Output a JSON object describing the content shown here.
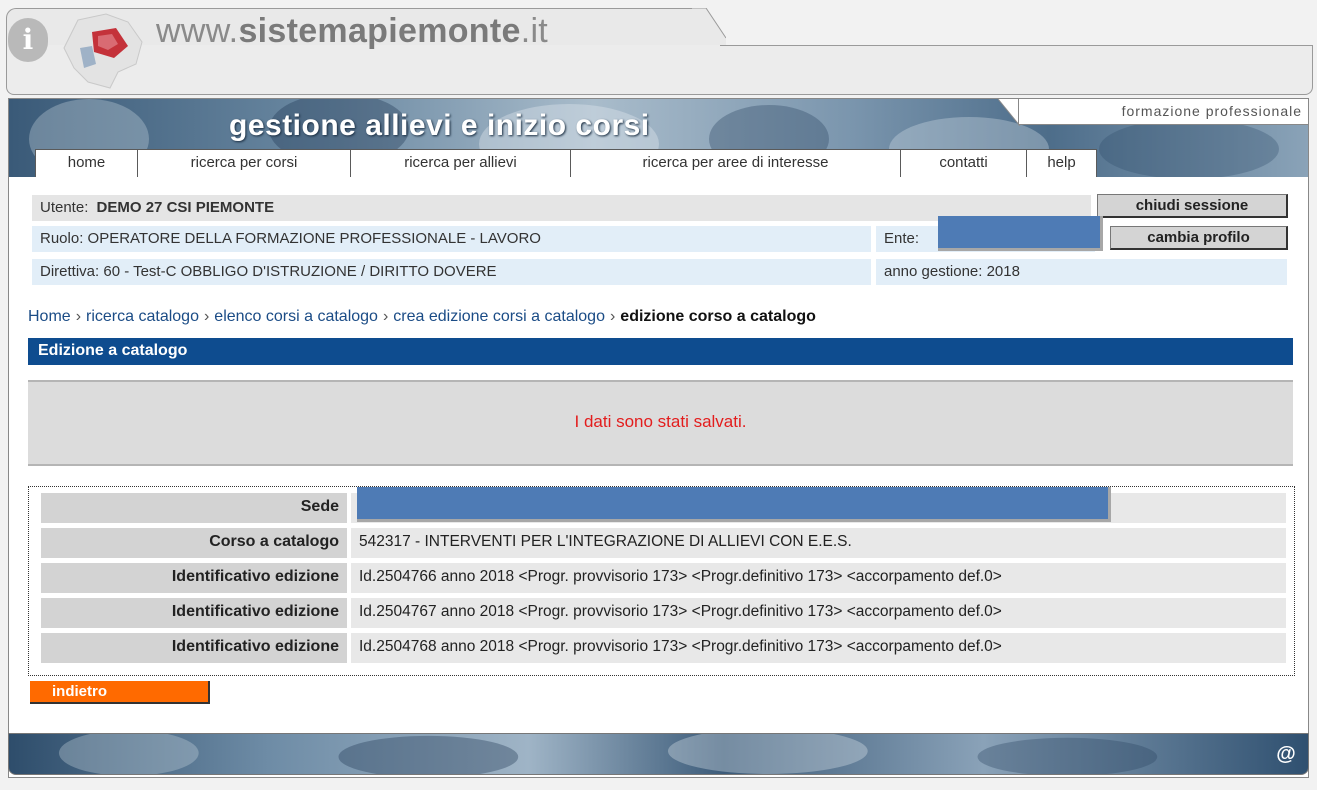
{
  "site": {
    "title_prefix": "www.",
    "title_brand": "sistemapiemonte",
    "title_suffix": ".it",
    "info_icon": "info-icon",
    "logo": "piemonte-region-logo"
  },
  "app": {
    "title": "gestione allievi e inizio corsi",
    "section_label": "formazione professionale"
  },
  "nav": {
    "items": [
      {
        "label": "home"
      },
      {
        "label": "ricerca per corsi"
      },
      {
        "label": "ricerca per allievi"
      },
      {
        "label": "ricerca per aree di interesse"
      },
      {
        "label": "contatti"
      },
      {
        "label": "help"
      }
    ]
  },
  "user": {
    "utente_label": "Utente:",
    "utente_value": "DEMO 27 CSI PIEMONTE",
    "ruolo": "Ruolo: OPERATORE DELLA FORMAZIONE PROFESSIONALE - LAVORO",
    "direttiva": "Direttiva: 60 - Test-C OBBLIGO D'ISTRUZIONE / DIRITTO DOVERE",
    "ente_label": "Ente:",
    "anno": "anno gestione: 2018",
    "chiudi_label": "chiudi sessione",
    "cambia_label": "cambia profilo"
  },
  "breadcrumb": {
    "items": [
      "Home",
      "ricerca catalogo",
      "elenco corsi a catalogo",
      "crea edizione corsi a catalogo"
    ],
    "current": "edizione corso a catalogo",
    "separator": "›"
  },
  "section": {
    "title": "Edizione a catalogo"
  },
  "message": {
    "text": "I dati sono stati salvati."
  },
  "details": {
    "rows": [
      {
        "label": "Sede",
        "value": ""
      },
      {
        "label": "Corso a catalogo",
        "value": "542317 - INTERVENTI PER L'INTEGRAZIONE DI ALLIEVI CON E.E.S."
      },
      {
        "label": "Identificativo edizione",
        "value": "Id.2504766 anno 2018 <Progr. provvisorio 173> <Progr.definitivo 173> <accorpamento def.0>"
      },
      {
        "label": "Identificativo edizione",
        "value": "Id.2504767 anno 2018 <Progr. provvisorio 173> <Progr.definitivo 173> <accorpamento def.0>"
      },
      {
        "label": "Identificativo edizione",
        "value": "Id.2504768 anno 2018 <Progr. provvisorio 173> <Progr.definitivo 173> <accorpamento def.0>"
      }
    ]
  },
  "actions": {
    "back_label": "indietro"
  },
  "footer": {
    "email_icon": "at-icon",
    "email_glyph": "@"
  },
  "colors": {
    "nav_bar": "#0e4c8f",
    "message": "#e31d1d",
    "back_button": "#ff6a00",
    "redaction": "#4e7bb5"
  }
}
